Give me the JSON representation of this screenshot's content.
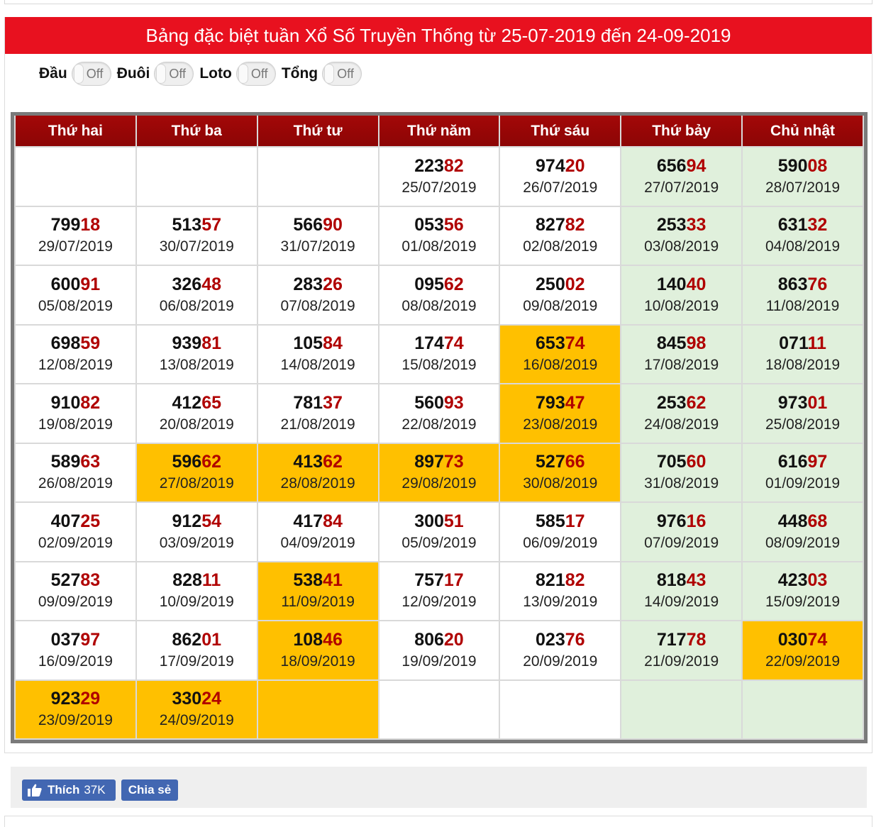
{
  "title": "Bảng đặc biệt tuần Xổ Số Truyền Thống từ 25-07-2019 đến 24-09-2019",
  "toggles": [
    {
      "label": "Đầu",
      "state": "Off"
    },
    {
      "label": "Đuôi",
      "state": "Off"
    },
    {
      "label": "Loto",
      "state": "Off"
    },
    {
      "label": "Tổng",
      "state": "Off"
    }
  ],
  "headers": [
    "Thứ hai",
    "Thứ ba",
    "Thứ tư",
    "Thứ năm",
    "Thứ sáu",
    "Thứ bảy",
    "Chủ nhật"
  ],
  "colors": {
    "title_bg": "#e8111f",
    "header_bg": "#a30808",
    "highlight": "#ffc000",
    "weekend": "#e0f0dc",
    "tail": "#b00000"
  },
  "rows": [
    [
      null,
      null,
      null,
      {
        "head": "223",
        "tail": "82",
        "date": "25/07/2019",
        "hl": false
      },
      {
        "head": "974",
        "tail": "20",
        "date": "26/07/2019",
        "hl": false
      },
      {
        "head": "656",
        "tail": "94",
        "date": "27/07/2019",
        "hl": false
      },
      {
        "head": "590",
        "tail": "08",
        "date": "28/07/2019",
        "hl": false
      }
    ],
    [
      {
        "head": "799",
        "tail": "18",
        "date": "29/07/2019",
        "hl": false
      },
      {
        "head": "513",
        "tail": "57",
        "date": "30/07/2019",
        "hl": false
      },
      {
        "head": "566",
        "tail": "90",
        "date": "31/07/2019",
        "hl": false
      },
      {
        "head": "053",
        "tail": "56",
        "date": "01/08/2019",
        "hl": false
      },
      {
        "head": "827",
        "tail": "82",
        "date": "02/08/2019",
        "hl": false
      },
      {
        "head": "253",
        "tail": "33",
        "date": "03/08/2019",
        "hl": false
      },
      {
        "head": "631",
        "tail": "32",
        "date": "04/08/2019",
        "hl": false
      }
    ],
    [
      {
        "head": "600",
        "tail": "91",
        "date": "05/08/2019",
        "hl": false
      },
      {
        "head": "326",
        "tail": "48",
        "date": "06/08/2019",
        "hl": false
      },
      {
        "head": "283",
        "tail": "26",
        "date": "07/08/2019",
        "hl": false
      },
      {
        "head": "095",
        "tail": "62",
        "date": "08/08/2019",
        "hl": false
      },
      {
        "head": "250",
        "tail": "02",
        "date": "09/08/2019",
        "hl": false
      },
      {
        "head": "140",
        "tail": "40",
        "date": "10/08/2019",
        "hl": false
      },
      {
        "head": "863",
        "tail": "76",
        "date": "11/08/2019",
        "hl": false
      }
    ],
    [
      {
        "head": "698",
        "tail": "59",
        "date": "12/08/2019",
        "hl": false
      },
      {
        "head": "939",
        "tail": "81",
        "date": "13/08/2019",
        "hl": false
      },
      {
        "head": "105",
        "tail": "84",
        "date": "14/08/2019",
        "hl": false
      },
      {
        "head": "174",
        "tail": "74",
        "date": "15/08/2019",
        "hl": false
      },
      {
        "head": "653",
        "tail": "74",
        "date": "16/08/2019",
        "hl": true
      },
      {
        "head": "845",
        "tail": "98",
        "date": "17/08/2019",
        "hl": false
      },
      {
        "head": "071",
        "tail": "11",
        "date": "18/08/2019",
        "hl": false
      }
    ],
    [
      {
        "head": "910",
        "tail": "82",
        "date": "19/08/2019",
        "hl": false
      },
      {
        "head": "412",
        "tail": "65",
        "date": "20/08/2019",
        "hl": false
      },
      {
        "head": "781",
        "tail": "37",
        "date": "21/08/2019",
        "hl": false
      },
      {
        "head": "560",
        "tail": "93",
        "date": "22/08/2019",
        "hl": false
      },
      {
        "head": "793",
        "tail": "47",
        "date": "23/08/2019",
        "hl": true
      },
      {
        "head": "253",
        "tail": "62",
        "date": "24/08/2019",
        "hl": false
      },
      {
        "head": "973",
        "tail": "01",
        "date": "25/08/2019",
        "hl": false
      }
    ],
    [
      {
        "head": "589",
        "tail": "63",
        "date": "26/08/2019",
        "hl": false
      },
      {
        "head": "596",
        "tail": "62",
        "date": "27/08/2019",
        "hl": true
      },
      {
        "head": "413",
        "tail": "62",
        "date": "28/08/2019",
        "hl": true
      },
      {
        "head": "897",
        "tail": "73",
        "date": "29/08/2019",
        "hl": true
      },
      {
        "head": "527",
        "tail": "66",
        "date": "30/08/2019",
        "hl": true
      },
      {
        "head": "705",
        "tail": "60",
        "date": "31/08/2019",
        "hl": false
      },
      {
        "head": "616",
        "tail": "97",
        "date": "01/09/2019",
        "hl": false
      }
    ],
    [
      {
        "head": "407",
        "tail": "25",
        "date": "02/09/2019",
        "hl": false
      },
      {
        "head": "912",
        "tail": "54",
        "date": "03/09/2019",
        "hl": false
      },
      {
        "head": "417",
        "tail": "84",
        "date": "04/09/2019",
        "hl": false
      },
      {
        "head": "300",
        "tail": "51",
        "date": "05/09/2019",
        "hl": false
      },
      {
        "head": "585",
        "tail": "17",
        "date": "06/09/2019",
        "hl": false
      },
      {
        "head": "976",
        "tail": "16",
        "date": "07/09/2019",
        "hl": false
      },
      {
        "head": "448",
        "tail": "68",
        "date": "08/09/2019",
        "hl": false
      }
    ],
    [
      {
        "head": "527",
        "tail": "83",
        "date": "09/09/2019",
        "hl": false
      },
      {
        "head": "828",
        "tail": "11",
        "date": "10/09/2019",
        "hl": false
      },
      {
        "head": "538",
        "tail": "41",
        "date": "11/09/2019",
        "hl": true
      },
      {
        "head": "757",
        "tail": "17",
        "date": "12/09/2019",
        "hl": false
      },
      {
        "head": "821",
        "tail": "82",
        "date": "13/09/2019",
        "hl": false
      },
      {
        "head": "818",
        "tail": "43",
        "date": "14/09/2019",
        "hl": false
      },
      {
        "head": "423",
        "tail": "03",
        "date": "15/09/2019",
        "hl": false
      }
    ],
    [
      {
        "head": "037",
        "tail": "97",
        "date": "16/09/2019",
        "hl": false
      },
      {
        "head": "862",
        "tail": "01",
        "date": "17/09/2019",
        "hl": false
      },
      {
        "head": "108",
        "tail": "46",
        "date": "18/09/2019",
        "hl": true
      },
      {
        "head": "806",
        "tail": "20",
        "date": "19/09/2019",
        "hl": false
      },
      {
        "head": "023",
        "tail": "76",
        "date": "20/09/2019",
        "hl": false
      },
      {
        "head": "717",
        "tail": "78",
        "date": "21/09/2019",
        "hl": false
      },
      {
        "head": "030",
        "tail": "74",
        "date": "22/09/2019",
        "hl": true
      }
    ],
    [
      {
        "head": "923",
        "tail": "29",
        "date": "23/09/2019",
        "hl": true
      },
      {
        "head": "330",
        "tail": "24",
        "date": "24/09/2019",
        "hl": true
      },
      {
        "empty_hl": true
      },
      null,
      null,
      null,
      null
    ]
  ],
  "footer": {
    "like_label": "Thích",
    "like_count": "37K",
    "share_label": "Chia sẻ",
    "like_icon": "thumbs-up-icon"
  }
}
